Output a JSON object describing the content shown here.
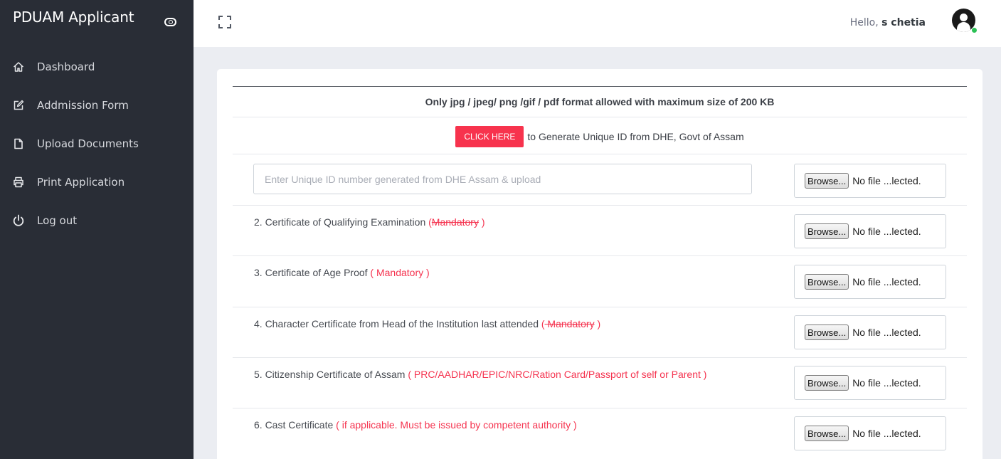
{
  "app": {
    "title": "PDUAM Applicant"
  },
  "sidebar": {
    "items": [
      {
        "label": "Dashboard",
        "icon": "home-icon"
      },
      {
        "label": "Addmission Form",
        "icon": "edit-icon"
      },
      {
        "label": "Upload Documents",
        "icon": "file-icon"
      },
      {
        "label": "Print Application",
        "icon": "printer-icon"
      },
      {
        "label": "Log out",
        "icon": "power-icon"
      }
    ]
  },
  "header": {
    "greeting": "Hello,",
    "user_name": "s chetia"
  },
  "main": {
    "format_note": "Only jpg / jpeg/ png /gif / pdf format allowed with maximum size of 200 KB",
    "click_button": "CLICK HERE",
    "generate_text": "to Generate Unique ID from DHE, Govt of Assam",
    "uid_placeholder": "Enter Unique ID number generated from DHE Assam & upload",
    "browse_label": "Browse...",
    "file_status": "No file ...lected.",
    "documents": [
      {
        "label": "2. Certificate of Qualifying Examination ",
        "req_open": "(",
        "req_word": "Mandatory",
        "req_close": " )"
      },
      {
        "label": "3. Certificate of Age Proof ",
        "req": "( Mandatory )"
      },
      {
        "label": "4. Character Certificate from Head of the Institution last attended ",
        "req_open": "(",
        "req_word": " Mandatory",
        "req_close": " )"
      },
      {
        "label": "5. Citizenship Certificate of Assam ",
        "req": "( PRC/AADHAR/EPIC/NRC/Ration Card/Passport of self or Parent )"
      },
      {
        "label": "6. Cast Certificate ",
        "req": "( if applicable. Must be issued by competent authority )"
      }
    ]
  },
  "colors": {
    "sidebar_bg": "#292d36",
    "accent_red": "#f7334d",
    "online_green": "#2bc155"
  }
}
